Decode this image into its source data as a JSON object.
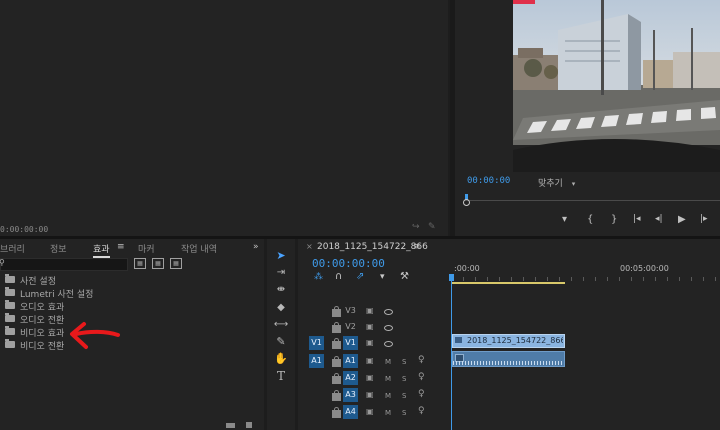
{
  "source_monitor": {
    "timecode": "0:00:00:00"
  },
  "program_monitor": {
    "timecode": "00:00:00",
    "fit_label": "맞추기",
    "controls": [
      "marker-icon",
      "in-point-icon",
      "out-point-icon",
      "go-to-in-icon",
      "step-back-icon",
      "play-icon",
      "step-forward-icon"
    ]
  },
  "effects_panel": {
    "tabs": [
      {
        "label": "브러리",
        "active": false
      },
      {
        "label": "정보",
        "active": false
      },
      {
        "label": "효과",
        "active": true
      },
      {
        "label": "마커",
        "active": false
      },
      {
        "label": "작업 내역",
        "active": false
      }
    ],
    "menu_glyph": "≡",
    "overflow_glyph": "»",
    "search_placeholder": "",
    "items": [
      "사전 설정",
      "Lumetri 사전 설정",
      "오디오 효과",
      "오디오 전환",
      "비디오 효과",
      "비디오 전환"
    ],
    "annotation": {
      "type": "red-arrow",
      "points_to": "비디오 효과",
      "color": "#e8191b"
    }
  },
  "timeline": {
    "sequence_name": "2018_1125_154722_866",
    "menu_glyph": "≡",
    "timecode": "00:00:00:00",
    "ruler": {
      "start": ":00:00",
      "mark": "00:05:00:00"
    },
    "video_tracks": [
      {
        "name": "V3",
        "source": ""
      },
      {
        "name": "V2",
        "source": ""
      },
      {
        "name": "V1",
        "source": "V1"
      }
    ],
    "audio_tracks": [
      {
        "name": "A1",
        "source": "A1",
        "m": "M",
        "s": "S"
      },
      {
        "name": "A2",
        "source": "",
        "m": "M",
        "s": "S"
      },
      {
        "name": "A3",
        "source": "",
        "m": "M",
        "s": "S"
      },
      {
        "name": "A4",
        "source": "",
        "m": "M",
        "s": "S"
      }
    ],
    "clip_label": "2018_1125_154722_866.M",
    "clip_tag": "fx"
  },
  "tools": [
    "selection-tool-icon",
    "track-select-tool-icon",
    "ripple-edit-tool-icon",
    "razor-tool-icon",
    "slip-tool-icon",
    "pen-tool-icon",
    "hand-tool-icon",
    "type-tool-icon"
  ],
  "colors": {
    "accent": "#3f9ae8",
    "clip_video": "#8ab4e0",
    "clip_audio": "#4f7ca8",
    "panel": "#232323"
  }
}
